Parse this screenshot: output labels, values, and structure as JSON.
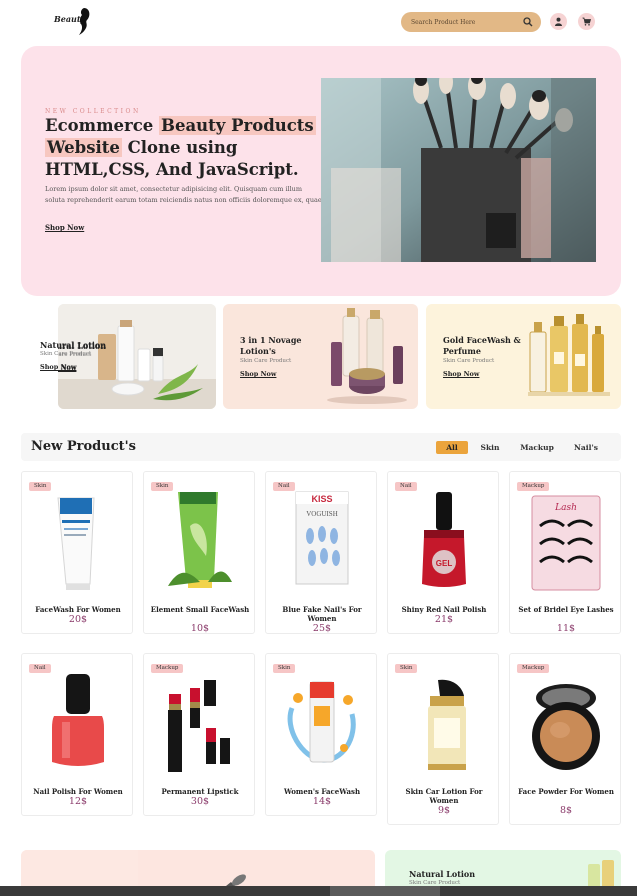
{
  "header": {
    "logo": "Beauty",
    "search_placeholder": "Search Product Here",
    "icons": [
      "search-icon",
      "user-icon",
      "cart-icon"
    ]
  },
  "hero": {
    "tag": "NEW COLLECTION",
    "title_part1": "Ecommerce ",
    "title_hl1": "Beauty Products",
    "title_hl2": "Website",
    "title_part2": " Clone using HTML,CSS, And JavaScript.",
    "description": "Lorem ipsum dolor sit amet, consectetur adipisicing elit. Quisquam cum illum soluta reprehenderit earum totam reiciendis natus non officiis doloremque ex, quae iste, e…",
    "cta": "Shop Now"
  },
  "promos": [
    {
      "title": "Natural Lotion",
      "subtitle": "Skin Care Product",
      "cta": "Shop Now",
      "bg": "#eeeae4"
    },
    {
      "title": "3 in 1 Novage Lotion's",
      "subtitle": "Skin Care Product",
      "cta": "Shop Now",
      "bg": "#fae6dc"
    },
    {
      "title": "Gold FaceWash & Perfume",
      "subtitle": "Skin Care Product",
      "cta": "Shop Now",
      "bg": "#fdf3dc"
    }
  ],
  "new_products": {
    "title": "New Product's",
    "tabs": [
      "All",
      "Skin",
      "Mackup",
      "Nail's"
    ],
    "active_tab": "All",
    "items": [
      {
        "tag": "Skin",
        "name": "FaceWash For Women",
        "price": "20$"
      },
      {
        "tag": "Skin",
        "name": "Element Small FaceWash",
        "price": "10$"
      },
      {
        "tag": "Nail",
        "name": "Blue Fake Nail's For Women",
        "price": "25$"
      },
      {
        "tag": "Nail",
        "name": "Shiny Red Nail Polish",
        "price": "21$"
      },
      {
        "tag": "Mackup",
        "name": "Set of Bridel Eye Lashes",
        "price": "11$"
      },
      {
        "tag": "Nail",
        "name": "Nail Polish For Women",
        "price": "12$"
      },
      {
        "tag": "Mackup",
        "name": "Permanent Lipstick",
        "price": "30$"
      },
      {
        "tag": "Skin",
        "name": "Women's FaceWash",
        "price": "14$"
      },
      {
        "tag": "Skin",
        "name": "Skin Car Lotion For Women",
        "price": "9$"
      },
      {
        "tag": "Mackup",
        "name": "Face Powder For Women",
        "price": "8$"
      }
    ]
  },
  "bottom": {
    "right_title": "Natural Lotion",
    "right_subtitle": "Skin Care Product"
  },
  "product_image_texts": {
    "vogue": "VOGUISH",
    "kiss": "KISS",
    "lash": "Lash",
    "gel": "GEL"
  }
}
